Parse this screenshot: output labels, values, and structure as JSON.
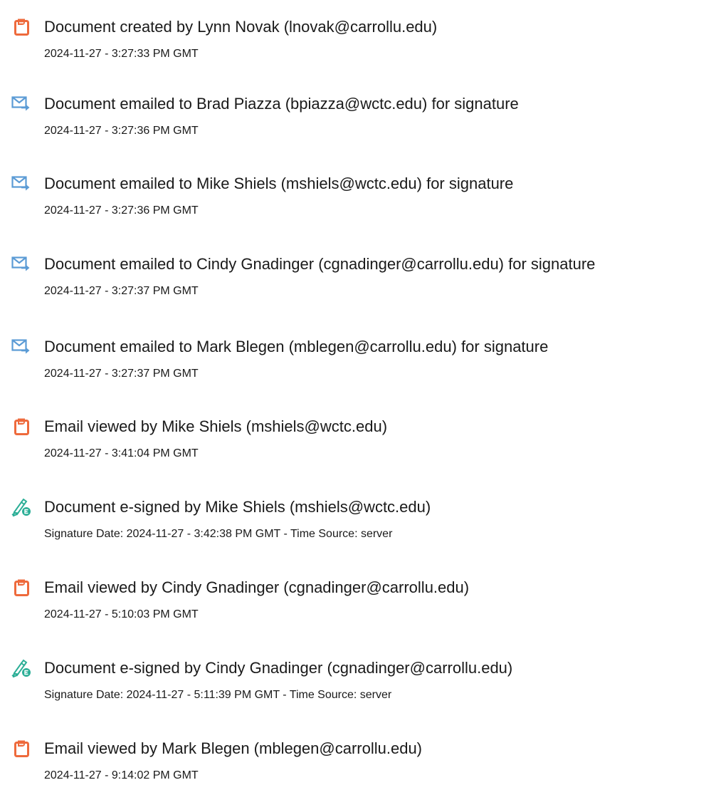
{
  "colors": {
    "created_icon": "#EE6A3C",
    "emailed_icon": "#5B9BD5",
    "signed_icon": "#2BAE96",
    "text": "#1a1a1a"
  },
  "events": [
    {
      "icon": "document-icon",
      "title": "Document created by Lynn Novak (lnovak@carrollu.edu)",
      "detail": "2024-11-27 - 3:27:33 PM GMT"
    },
    {
      "icon": "email-send-icon",
      "title": "Document emailed to Brad Piazza (bpiazza@wctc.edu) for signature",
      "detail": "2024-11-27 - 3:27:36 PM GMT"
    },
    {
      "icon": "email-send-icon",
      "title": "Document emailed to Mike Shiels (mshiels@wctc.edu) for signature",
      "detail": "2024-11-27 - 3:27:36 PM GMT"
    },
    {
      "icon": "email-send-icon",
      "title": "Document emailed to Cindy Gnadinger (cgnadinger@carrollu.edu) for signature",
      "detail": "2024-11-27 - 3:27:37 PM GMT"
    },
    {
      "icon": "email-send-icon",
      "title": "Document emailed to Mark Blegen (mblegen@carrollu.edu) for signature",
      "detail": "2024-11-27 - 3:27:37 PM GMT"
    },
    {
      "icon": "document-icon",
      "title": "Email viewed by Mike Shiels (mshiels@wctc.edu)",
      "detail": "2024-11-27 - 3:41:04 PM GMT"
    },
    {
      "icon": "e-sign-pen-icon",
      "title": "Document e-signed by Mike Shiels (mshiels@wctc.edu)",
      "detail": "Signature Date: 2024-11-27 - 3:42:38 PM GMT - Time Source: server"
    },
    {
      "icon": "document-icon",
      "title": "Email viewed by Cindy Gnadinger (cgnadinger@carrollu.edu)",
      "detail": "2024-11-27 - 5:10:03 PM GMT"
    },
    {
      "icon": "e-sign-pen-icon",
      "title": "Document e-signed by Cindy Gnadinger (cgnadinger@carrollu.edu)",
      "detail": "Signature Date: 2024-11-27 - 5:11:39 PM GMT - Time Source: server"
    },
    {
      "icon": "document-icon",
      "title": "Email viewed by Mark Blegen (mblegen@carrollu.edu)",
      "detail": "2024-11-27 - 9:14:02 PM GMT"
    }
  ]
}
